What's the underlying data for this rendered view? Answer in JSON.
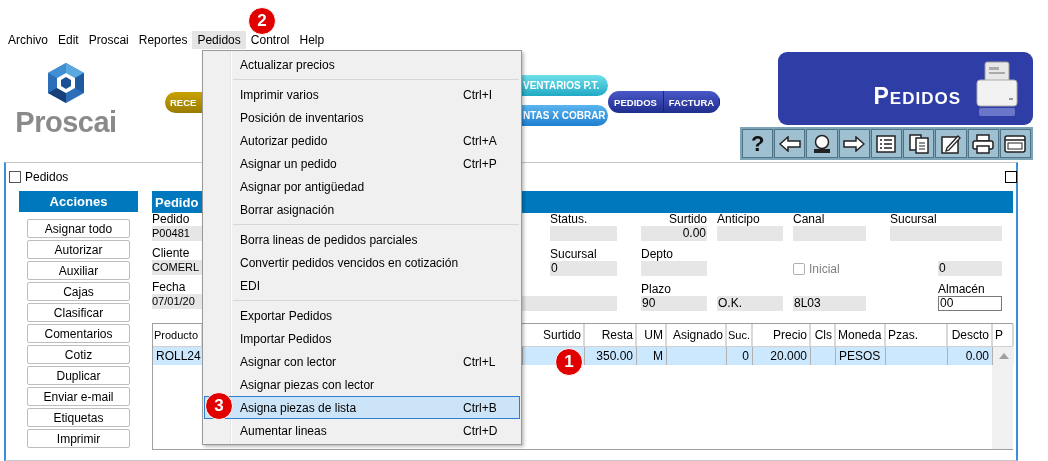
{
  "menubar": [
    {
      "label": "Archivo",
      "selected": false
    },
    {
      "label": "Edit",
      "selected": false
    },
    {
      "label": "Proscai",
      "selected": false
    },
    {
      "label": "Reportes",
      "selected": false
    },
    {
      "label": "Pedidos",
      "selected": true
    },
    {
      "label": "Control",
      "selected": false
    },
    {
      "label": "Help",
      "selected": false
    }
  ],
  "header": {
    "logo_text": "Proscai",
    "yellow_pill": "RECE",
    "cyan_pills": [
      "VENTARIOS P.T.",
      "NTAS X COBRAR"
    ],
    "navy_pill": [
      "PEDIDOS",
      "FACTURA"
    ],
    "banner": "PEDIDOS"
  },
  "toolbar": [
    {
      "kind": "help",
      "glyph": "?"
    },
    {
      "kind": "back"
    },
    {
      "kind": "search"
    },
    {
      "kind": "forward"
    },
    {
      "kind": "list"
    },
    {
      "kind": "copy"
    },
    {
      "kind": "edit"
    },
    {
      "kind": "print"
    },
    {
      "kind": "window"
    }
  ],
  "window": {
    "title": "Pedidos"
  },
  "actions": {
    "title": "Acciones",
    "buttons": [
      "Asignar todo",
      "Autorizar",
      "Auxiliar",
      "Cajas",
      "Clasificar",
      "Comentarios",
      "Cotiz",
      "Duplicar",
      "Enviar e-mail",
      "Etiquetas",
      "Imprimir"
    ]
  },
  "form": {
    "title": "Pedido",
    "left_fields": [
      {
        "label": "Pedido",
        "value": "P00481"
      },
      {
        "label": "Cliente",
        "value": "COMERL"
      },
      {
        "label": "Fecha",
        "value": "07/01/20"
      }
    ],
    "right_fields": [
      {
        "label": "Status.",
        "kind": "field"
      },
      {
        "label": "Surtido",
        "value": "0.00",
        "kind": "field"
      },
      {
        "label": "Anticipo",
        "kind": "field"
      },
      {
        "label": "Canal",
        "kind": "field"
      },
      {
        "label": "Sucursal",
        "kind": "field"
      },
      {
        "label": "Sucursal",
        "value": "0",
        "kind": "field"
      },
      {
        "label": "Depto",
        "kind": "field"
      },
      {
        "value": "0",
        "kind": "field"
      },
      {
        "kind": "field"
      },
      {
        "label": "Plazo",
        "value": "90",
        "kind": "field"
      },
      {
        "value": "O.K.",
        "kind": "field"
      },
      {
        "value": "8L03",
        "kind": "field"
      },
      {
        "label": "Almacén",
        "value": "00",
        "kind": "input"
      }
    ],
    "checkbox": {
      "label": "Inicial",
      "checked": false,
      "disabled": true
    }
  },
  "table": {
    "columns": [
      {
        "label": "Producto"
      },
      {},
      {
        "label": "Surtido"
      },
      {
        "label": "Resta"
      },
      {
        "label": "UM"
      },
      {
        "label": "Asignado"
      },
      {
        "label": "Suc."
      },
      {
        "label": "Precio"
      },
      {
        "label": "Cls"
      },
      {
        "label": "Moneda"
      },
      {
        "label": "Pzas."
      },
      {
        "label": "Descto"
      },
      {
        "label": "P"
      }
    ],
    "rows": [
      {
        "selected": true,
        "cells": [
          "ROLL24",
          null,
          null,
          "350.00",
          "M",
          null,
          "0",
          "20.000",
          null,
          "PESOS",
          null,
          "0.00"
        ]
      }
    ]
  },
  "menu": [
    {
      "kind": "item",
      "label": "Actualizar precios",
      "selected": false
    },
    {
      "kind": "separator"
    },
    {
      "kind": "item",
      "label": "Imprimir varios",
      "shortcut": "Ctrl+I",
      "selected": false
    },
    {
      "kind": "item",
      "label": "Posición de inventarios",
      "selected": false
    },
    {
      "kind": "item",
      "label": "Autorizar pedido",
      "shortcut": "Ctrl+A",
      "selected": false
    },
    {
      "kind": "item",
      "label": "Asignar un pedido",
      "shortcut": "Ctrl+P",
      "selected": false
    },
    {
      "kind": "item",
      "label": "Asignar por antigüedad",
      "selected": false
    },
    {
      "kind": "item",
      "label": "Borrar asignación",
      "selected": false
    },
    {
      "kind": "separator"
    },
    {
      "kind": "item",
      "label": "Borra lineas de pedidos parciales",
      "selected": false
    },
    {
      "kind": "item",
      "label": "Convertir pedidos vencidos en cotización",
      "selected": false
    },
    {
      "kind": "item",
      "label": "EDI",
      "selected": false
    },
    {
      "kind": "separator"
    },
    {
      "kind": "item",
      "label": "Exportar Pedidos",
      "selected": false
    },
    {
      "kind": "item",
      "label": "Importar Pedidos",
      "selected": false
    },
    {
      "kind": "item",
      "label": "Asignar con lector",
      "shortcut": "Ctrl+L",
      "selected": false
    },
    {
      "kind": "item",
      "label": "Asignar piezas con lector",
      "selected": false
    },
    {
      "kind": "item",
      "label": "Asigna piezas de lista",
      "shortcut": "Ctrl+B",
      "selected": true
    },
    {
      "kind": "item",
      "label": "Aumentar lineas",
      "shortcut": "Ctrl+D",
      "selected": false
    }
  ],
  "callouts": [
    {
      "label": "1"
    },
    {
      "label": "2"
    },
    {
      "label": "3"
    }
  ]
}
